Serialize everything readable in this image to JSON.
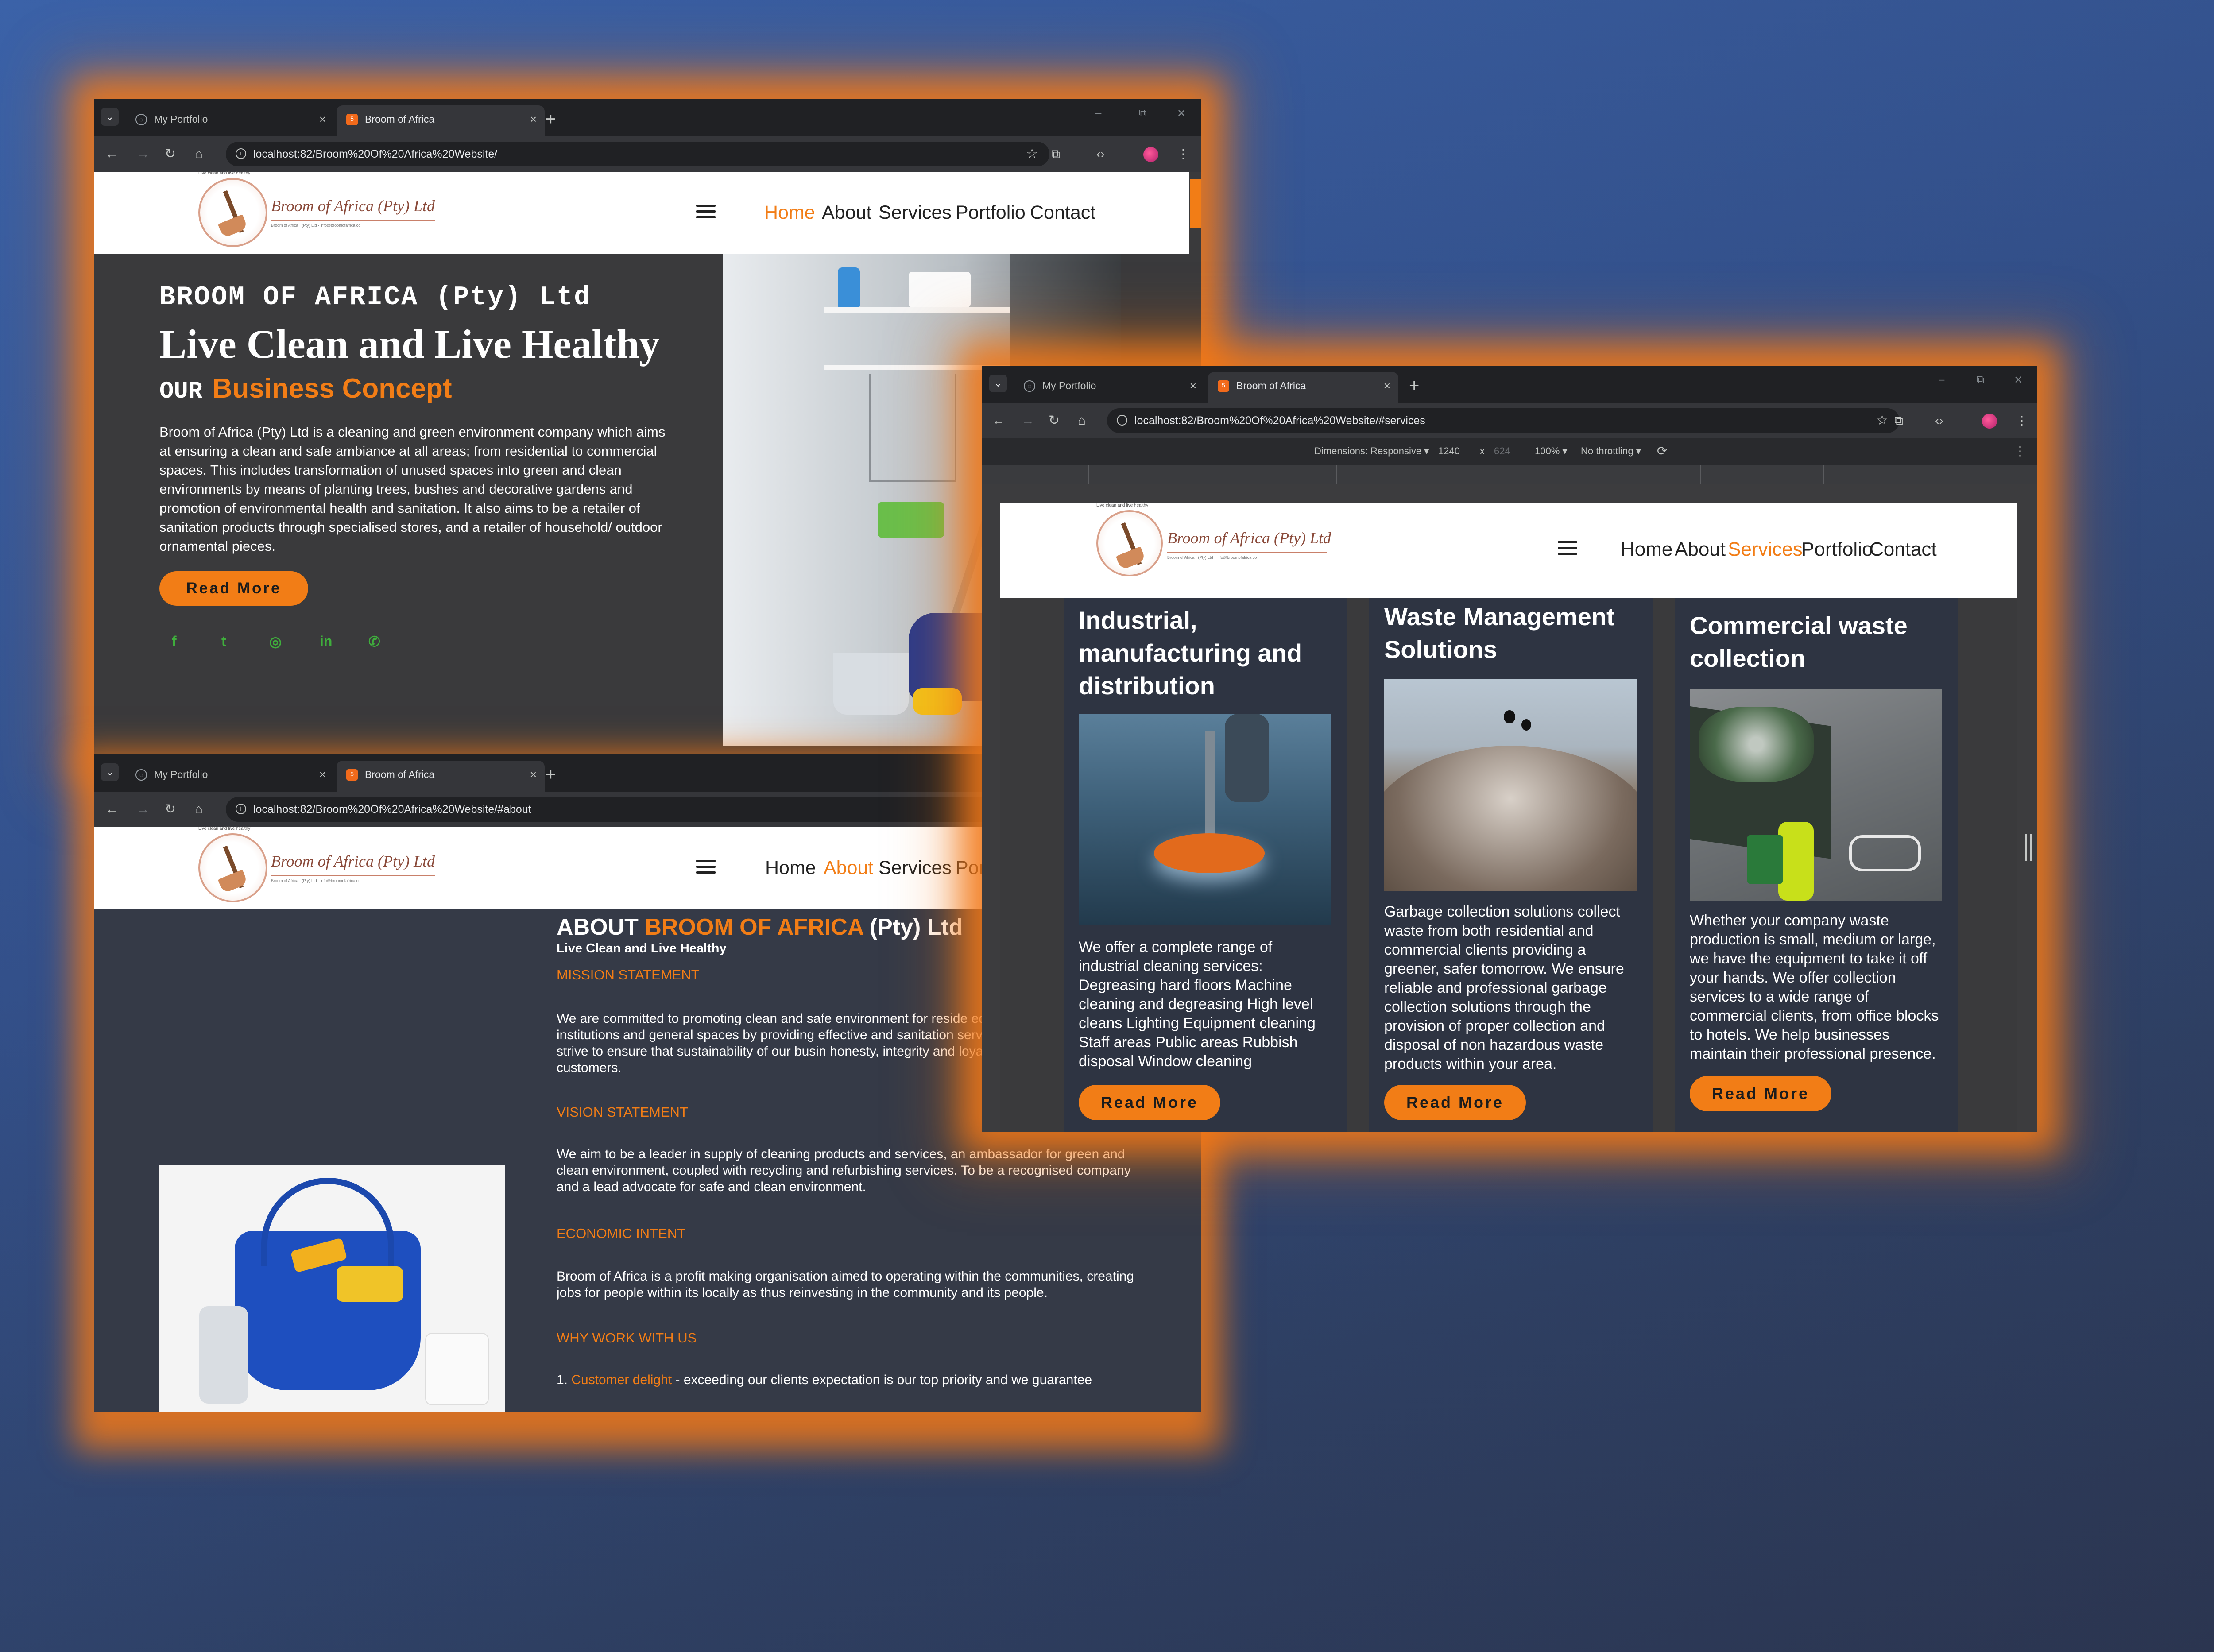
{
  "browser": {
    "tabs": [
      {
        "title": "My Portfolio"
      },
      {
        "title": "Broom of Africa"
      }
    ],
    "new_tab": "+",
    "tab_close": "×",
    "window_controls": [
      "–",
      "⧉",
      "✕"
    ],
    "back": "←",
    "forward": "→",
    "reload": "↻",
    "home": "⌂",
    "bookmark": "☆",
    "extensions": "⧉",
    "devtools_icon": "‹›",
    "menu": "⋮"
  },
  "site": {
    "logo": {
      "tagline": "Live clean and live healthy",
      "name": "Broom of Africa (Pty) Ltd",
      "contact": "Broom of Africa · (Pty) Ltd · info@broomofafrica.co"
    },
    "nav": [
      "Home",
      "About",
      "Services",
      "Portfolio",
      "Contact"
    ]
  },
  "window_home": {
    "url": "localhost:82/Broom%20Of%20Africa%20Website/",
    "active_nav": "Home",
    "hero": {
      "company": "BROOM OF AFRICA (Pty) Ltd",
      "slogan": "Live Clean and Live Healthy",
      "concept_prefix": "OUR",
      "concept_highlight": "Business Concept",
      "description": "Broom of Africa (Pty) Ltd is a cleaning and green environment company which aims at ensuring a clean and safe ambiance at all areas; from residential to commercial spaces. This includes transformation of unused spaces into green and clean environments by means of planting trees, bushes and decorative gardens and promotion of environmental health and sanitation. It also aims to be a retailer of sanitation products through specialised stores, and a retailer of household/ outdoor ornamental pieces.",
      "button": "Read More",
      "social_icons": [
        "f",
        "t",
        "◎",
        "in",
        "✆"
      ]
    }
  },
  "window_about": {
    "url": "localhost:82/Broom%20Of%20Africa%20Website/#about",
    "active_nav": "About",
    "nav_clipped": [
      "Home",
      "About",
      "Services",
      "Por"
    ],
    "heading_prefix": "ABOUT",
    "heading_highlight": "BROOM OF AFRICA",
    "heading_suffix": "(Pty) Ltd",
    "subheading": "Live Clean and Live Healthy",
    "sections": [
      {
        "title": "MISSION STATEMENT",
        "text": "We are committed to promoting clean and safe environment for reside educational institutions and general spaces by providing effective and sanitation services. We strive to ensure that sustainability of our busin honesty, integrity and loyalty to our customers."
      },
      {
        "title": "VISION STATEMENT",
        "text": "We aim to be a leader in supply of cleaning products and services, an ambassador for green and clean environment, coupled with recycling and refurbishing services. To be a recognised company and a lead advocate for safe and clean environment."
      },
      {
        "title": "ECONOMIC INTENT",
        "text": "Broom of Africa is a profit making organisation aimed to operating within the communities, creating jobs for people within its locally as thus reinvesting in the community and its people."
      },
      {
        "title": "WHY WORK WITH US",
        "text": ""
      }
    ],
    "why_item_number": "1.",
    "why_item_highlight": "Customer delight",
    "why_item_text": " - exceeding our clients expectation is our top priority and we guarantee"
  },
  "window_services": {
    "url": "localhost:82/Broom%20Of%20Africa%20Website/#services",
    "active_nav": "Services",
    "devtools": {
      "dimensions_label": "Dimensions: Responsive ▾",
      "width": "1240",
      "times": "x",
      "height": "624",
      "zoom": "100% ▾",
      "throttling": "No throttling ▾"
    },
    "cards": [
      {
        "title": "Industrial, manufacturing and distribution",
        "text": "We offer a complete range of industrial cleaning services: Degreasing hard floors Machine cleaning and degreasing High level cleans Lighting Equipment cleaning Staff areas Public areas Rubbish disposal Window cleaning",
        "button": "Read More"
      },
      {
        "title": "Waste Management Solutions",
        "text": "Garbage collection solutions collect waste from both residential and commercial clients providing a greener, safer tomorrow. We ensure reliable and professional garbage collection solutions through the provision of proper collection and disposal of non hazardous waste products within your area.",
        "button": "Read More"
      },
      {
        "title": "Commercial waste collection",
        "text": "Whether your company waste production is small, medium or large, we have the equipment to take it off your hands. We offer collection services to a wide range of commercial clients, from office blocks to hotels. We help businesses maintain their professional presence.",
        "button": "Read More"
      }
    ]
  },
  "colors": {
    "accent": "#f27d16",
    "page_bg": "#3a3a3c",
    "chrome_bg": "#202124",
    "social": "#3fae3c"
  }
}
